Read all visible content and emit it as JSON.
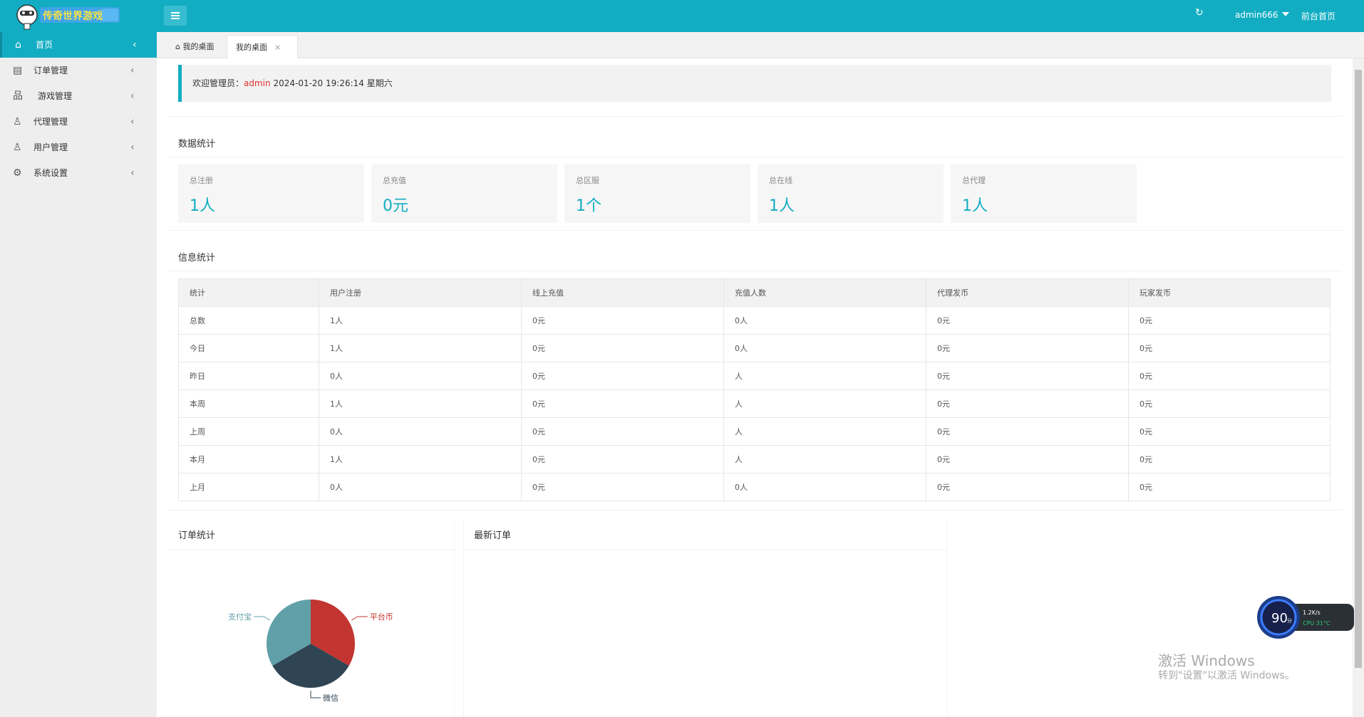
{
  "header": {
    "logo_alt": "logo",
    "admin_name": "admin666",
    "home_link": "前台首页"
  },
  "sidebar": {
    "items": [
      {
        "label": "首页",
        "icon": "home-icon"
      },
      {
        "label": "订单管理",
        "icon": "document-icon"
      },
      {
        "label": "游戏管理",
        "icon": "sitemap-icon"
      },
      {
        "label": "代理管理",
        "icon": "user-icon"
      },
      {
        "label": "用户管理",
        "icon": "user-icon"
      },
      {
        "label": "系统设置",
        "icon": "gear-icon"
      }
    ]
  },
  "tabs": {
    "home": "我的桌面",
    "current": "我的桌面"
  },
  "welcome": {
    "prefix": "欢迎管理员：",
    "user": "admin",
    "datetime": "2024-01-20  19:26:14  星期六"
  },
  "data_stats": {
    "title": "数据统计",
    "cards": [
      {
        "label": "总注册",
        "value": "1人"
      },
      {
        "label": "总充值",
        "value": "0元"
      },
      {
        "label": "总区服",
        "value": "1个"
      },
      {
        "label": "总在线",
        "value": "1人"
      },
      {
        "label": "总代理",
        "value": "1人"
      }
    ]
  },
  "info_stats": {
    "title": "信息统计",
    "headers": [
      "统计",
      "用户注册",
      "线上充值",
      "充值人数",
      "代理发币",
      "玩家发币"
    ],
    "rows": [
      [
        "总数",
        "1人",
        "0元",
        "0人",
        "0元",
        "0元"
      ],
      [
        "今日",
        "1人",
        "0元",
        "0人",
        "0元",
        "0元"
      ],
      [
        "昨日",
        "0人",
        "0元",
        "人",
        "0元",
        "0元"
      ],
      [
        "本周",
        "1人",
        "0元",
        "人",
        "0元",
        "0元"
      ],
      [
        "上周",
        "0人",
        "0元",
        "人",
        "0元",
        "0元"
      ],
      [
        "本月",
        "1人",
        "0元",
        "人",
        "0元",
        "0元"
      ],
      [
        "上月",
        "0人",
        "0元",
        "0人",
        "0元",
        "0元"
      ]
    ]
  },
  "order_stats": {
    "title": "订单统计"
  },
  "latest_orders": {
    "title": "最新订单"
  },
  "chart_data": {
    "type": "pie",
    "categories": [
      "平台币",
      "微信",
      "支付宝"
    ],
    "values": [
      1,
      1,
      1
    ],
    "colors": [
      "#c23531",
      "#2f4554",
      "#61a0a8"
    ]
  },
  "widget": {
    "score": "90",
    "score_unit": "分",
    "speed": "1.2K/s",
    "cpu": "CPU 31°C"
  },
  "watermark": {
    "line1": "激活 Windows",
    "line2": "转到\"设置\"以激活 Windows。"
  }
}
